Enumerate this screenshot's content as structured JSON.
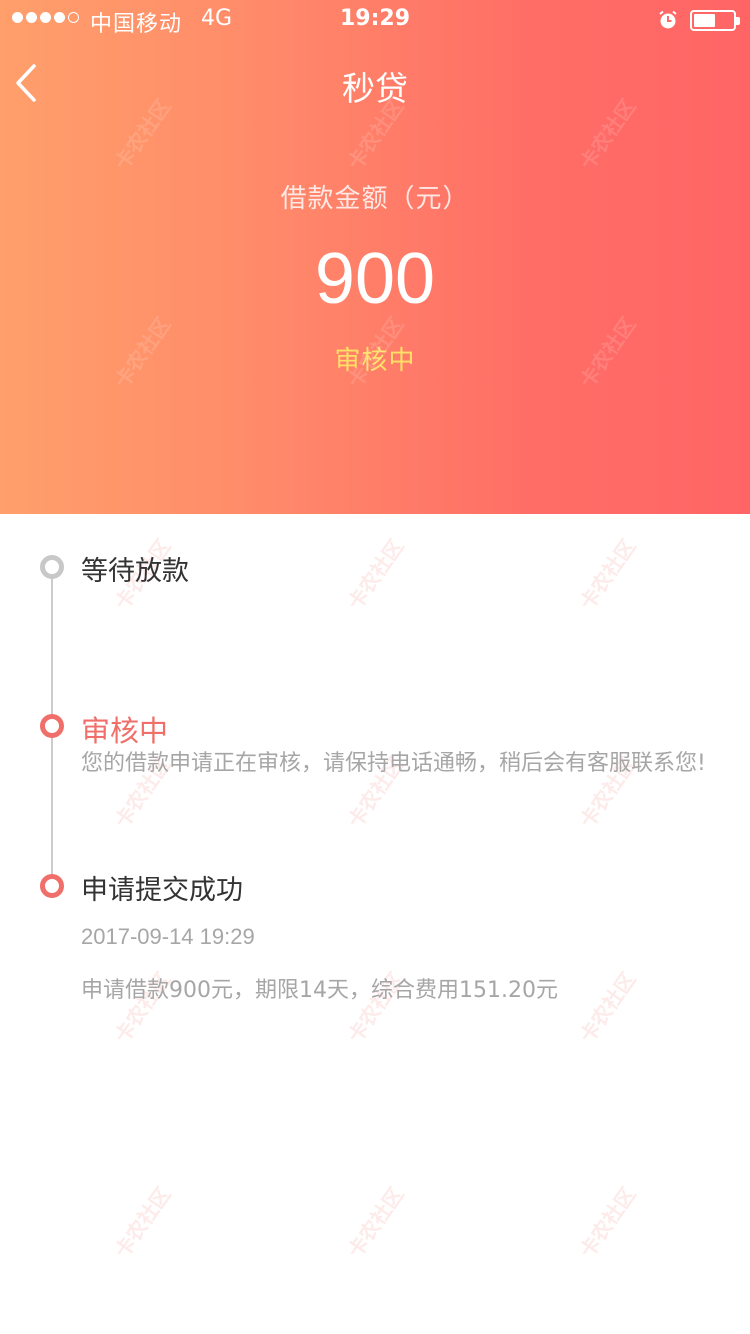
{
  "status_bar": {
    "carrier": "中国移动",
    "network": "4G",
    "time": "19:29",
    "battery_level": 0.55
  },
  "nav": {
    "title": "秒贷",
    "back_icon": "chevron-left-icon"
  },
  "loan": {
    "amount_label": "借款金额（元）",
    "amount": "900",
    "status": "审核中"
  },
  "timeline": [
    {
      "title": "等待放款",
      "state": "pending"
    },
    {
      "title": "审核中",
      "state": "active",
      "description": "您的借款申请正在审核，请保持电话通畅，稍后会有客服联系您!"
    },
    {
      "title": "申请提交成功",
      "state": "done",
      "time": "2017-09-14 19:29",
      "detail": "申请借款900元，期限14天，综合费用151.20元"
    }
  ],
  "watermark_text": "卡农社区",
  "colors": {
    "gradient_start": "#ff9f6b",
    "gradient_end": "#ff6565",
    "accent": "#f06f6a",
    "status_yellow": "#ffe066"
  }
}
